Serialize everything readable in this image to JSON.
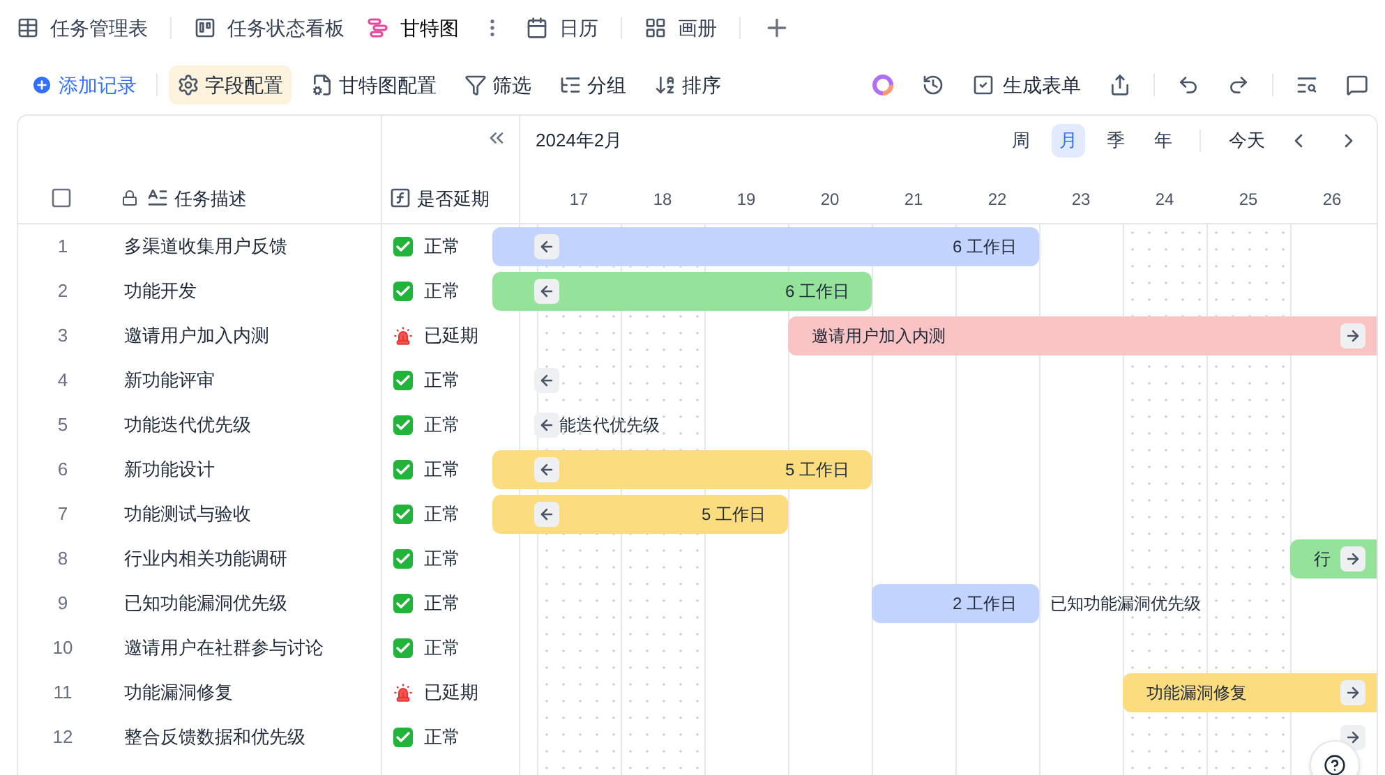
{
  "view_tabs": [
    {
      "label": "任务管理表",
      "kind": "table",
      "selected": false
    },
    {
      "label": "任务状态看板",
      "kind": "kanban",
      "selected": false
    },
    {
      "label": "甘特图",
      "kind": "gantt",
      "selected": true
    },
    {
      "label": "日历",
      "kind": "calendar",
      "selected": false
    },
    {
      "label": "画册",
      "kind": "gallery",
      "selected": false
    }
  ],
  "toolbar": [
    {
      "label": "添加记录",
      "kind": "add",
      "selected": false
    },
    {
      "label": "字段配置",
      "kind": "fields",
      "selected": true
    },
    {
      "label": "甘特图配置",
      "kind": "gantt",
      "selected": false
    },
    {
      "label": "筛选",
      "kind": "filter",
      "selected": false
    },
    {
      "label": "分组",
      "kind": "group",
      "selected": false
    },
    {
      "label": "排序",
      "kind": "sort",
      "selected": false
    }
  ],
  "form_button": "生成表单",
  "select_all": {
    "checked": false
  },
  "columns": {
    "task": "任务描述",
    "status": "是否延期"
  },
  "gantt": {
    "month": "2024年2月",
    "scales": [
      {
        "label": "周",
        "selected": false
      },
      {
        "label": "月",
        "selected": true
      },
      {
        "label": "季",
        "selected": false
      },
      {
        "label": "年",
        "selected": false
      }
    ],
    "today": "今天",
    "days": [
      {
        "label": "17",
        "weekend": true
      },
      {
        "label": "18",
        "weekend": true
      },
      {
        "label": "19",
        "weekend": false
      },
      {
        "label": "20",
        "weekend": false
      },
      {
        "label": "21",
        "weekend": false
      },
      {
        "label": "22",
        "weekend": false
      },
      {
        "label": "23",
        "weekend": false
      },
      {
        "label": "24",
        "weekend": true
      },
      {
        "label": "25",
        "weekend": true
      },
      {
        "label": "26",
        "weekend": false
      }
    ]
  },
  "rows": [
    {
      "index": "1",
      "task": "多渠道收集用户反馈",
      "status": {
        "kind": "normal",
        "text": "正常"
      },
      "bar": {
        "color": "#c2d4fd",
        "kind": "duration",
        "label": "6 工作日",
        "start": {
          "kind": "offscreen"
        },
        "end": {
          "kind": "day22"
        }
      },
      "arrow": {
        "kind": "left"
      }
    },
    {
      "index": "2",
      "task": "功能开发",
      "status": {
        "kind": "normal",
        "text": "正常"
      },
      "bar": {
        "color": "#95e39a",
        "kind": "duration",
        "label": "6 工作日",
        "start": {
          "kind": "offscreen"
        },
        "end": {
          "kind": "day20"
        }
      },
      "arrow": {
        "kind": "left"
      }
    },
    {
      "index": "3",
      "task": "邀请用户加入内测",
      "status": {
        "kind": "delayed",
        "text": "已延期"
      },
      "bar": {
        "color": "#fbc4c4",
        "kind": "name",
        "label": "邀请用户加入内测",
        "start": {
          "kind": "day20"
        },
        "end": {
          "kind": "offscreen"
        }
      },
      "arrow": {
        "kind": "right"
      }
    },
    {
      "index": "4",
      "task": "新功能评审",
      "status": {
        "kind": "normal",
        "text": "正常"
      },
      "arrow": {
        "kind": "left"
      }
    },
    {
      "index": "5",
      "task": "功能迭代优先级",
      "status": {
        "kind": "normal",
        "text": "正常"
      },
      "arrow": {
        "kind": "left"
      },
      "outside_label": "能迭代优先级"
    },
    {
      "index": "6",
      "task": "新功能设计",
      "status": {
        "kind": "normal",
        "text": "正常"
      },
      "bar": {
        "color": "#fbdc7e",
        "kind": "duration",
        "label": "5 工作日",
        "start": {
          "kind": "offscreen"
        },
        "end": {
          "kind": "day20"
        }
      },
      "arrow": {
        "kind": "left"
      }
    },
    {
      "index": "7",
      "task": "功能测试与验收",
      "status": {
        "kind": "normal",
        "text": "正常"
      },
      "bar": {
        "color": "#fbdc7e",
        "kind": "duration",
        "label": "5 工作日",
        "start": {
          "kind": "offscreen"
        },
        "end": {
          "kind": "day19"
        }
      },
      "arrow": {
        "kind": "left"
      }
    },
    {
      "index": "8",
      "task": "行业内相关功能调研",
      "status": {
        "kind": "normal",
        "text": "正常"
      },
      "bar": {
        "color": "#95e39a",
        "kind": "name",
        "label": "行",
        "start": {
          "kind": "day26"
        },
        "end": {
          "kind": "offscreen"
        }
      },
      "arrow": {
        "kind": "right"
      }
    },
    {
      "index": "9",
      "task": "已知功能漏洞优先级",
      "status": {
        "kind": "normal",
        "text": "正常"
      },
      "bar": {
        "color": "#c2d4fd",
        "kind": "duration",
        "label": "2 工作日",
        "start": {
          "kind": "day21"
        },
        "end": {
          "kind": "day22"
        }
      },
      "outside_label": "已知功能漏洞优先级"
    },
    {
      "index": "10",
      "task": "邀请用户在社群参与讨论",
      "status": {
        "kind": "normal",
        "text": "正常"
      }
    },
    {
      "index": "11",
      "task": "功能漏洞修复",
      "status": {
        "kind": "delayed",
        "text": "已延期"
      },
      "bar": {
        "color": "#fbdc7e",
        "kind": "name",
        "label": "功能漏洞修复",
        "start": {
          "kind": "day24"
        },
        "end": {
          "kind": "offscreen"
        }
      },
      "arrow": {
        "kind": "right"
      }
    },
    {
      "index": "12",
      "task": "整合反馈数据和优先级",
      "status": {
        "kind": "normal",
        "text": "正常"
      },
      "arrow": {
        "kind": "right"
      }
    }
  ]
}
